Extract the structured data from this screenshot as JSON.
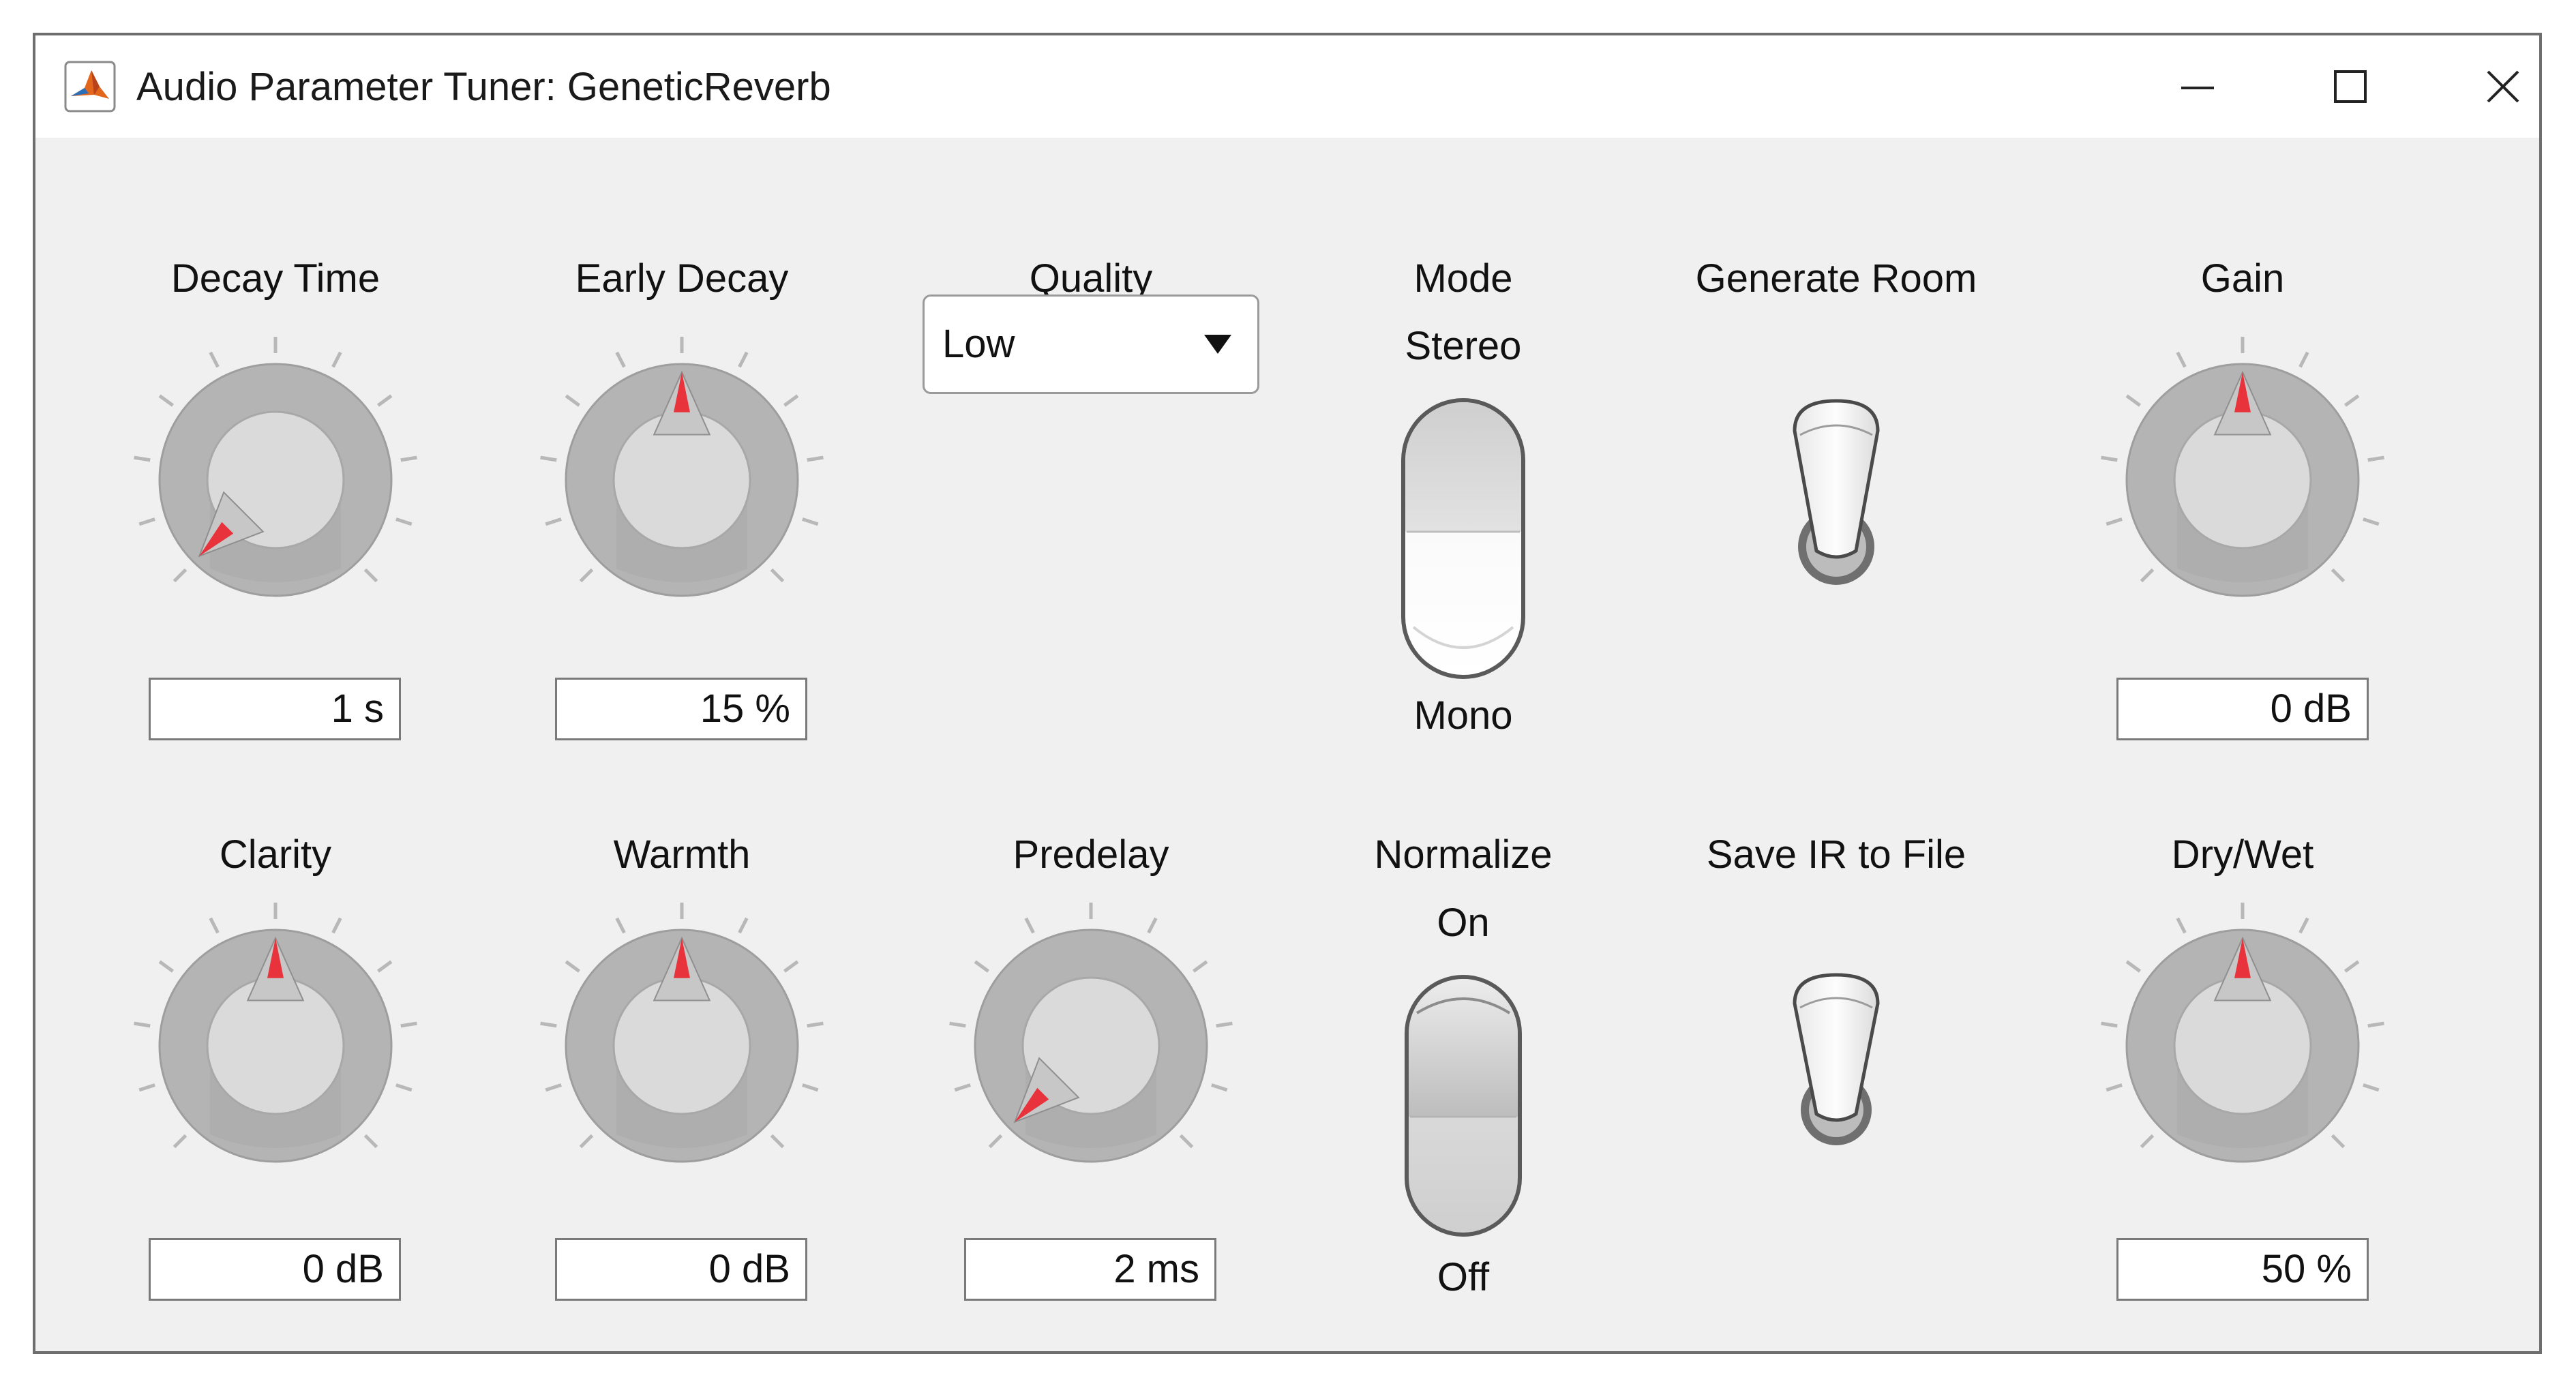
{
  "window": {
    "title": "Audio Parameter Tuner: GeneticReverb",
    "minimize_icon": "minimize-icon",
    "maximize_icon": "maximize-icon",
    "close_icon": "close-icon"
  },
  "colors": {
    "pointer_red": "#e8323c",
    "knob_outer": "#b4b4b4",
    "knob_inner": "#dadada",
    "panel_bg": "#f0f0f0"
  },
  "controls": {
    "decay_time": {
      "label": "Decay Time",
      "value": "1 s",
      "dial_fraction": 0.0
    },
    "early_decay": {
      "label": "Early Decay",
      "value": "15 %",
      "dial_fraction": 0.5
    },
    "quality": {
      "label": "Quality",
      "selected": "Low"
    },
    "mode": {
      "label": "Mode",
      "top_option": "Stereo",
      "bottom_option": "Mono",
      "state": "Mono"
    },
    "generate_room": {
      "label": "Generate Room"
    },
    "gain": {
      "label": "Gain",
      "value": "0 dB",
      "dial_fraction": 0.5
    },
    "clarity": {
      "label": "Clarity",
      "value": "0 dB",
      "dial_fraction": 0.5
    },
    "warmth": {
      "label": "Warmth",
      "value": "0 dB",
      "dial_fraction": 0.5
    },
    "predelay": {
      "label": "Predelay",
      "value": "2 ms",
      "dial_fraction": 0.0
    },
    "normalize": {
      "label": "Normalize",
      "top_option": "On",
      "bottom_option": "Off",
      "state": "On"
    },
    "save_ir": {
      "label": "Save IR to File"
    },
    "dry_wet": {
      "label": "Dry/Wet",
      "value": "50 %",
      "dial_fraction": 0.5
    }
  }
}
